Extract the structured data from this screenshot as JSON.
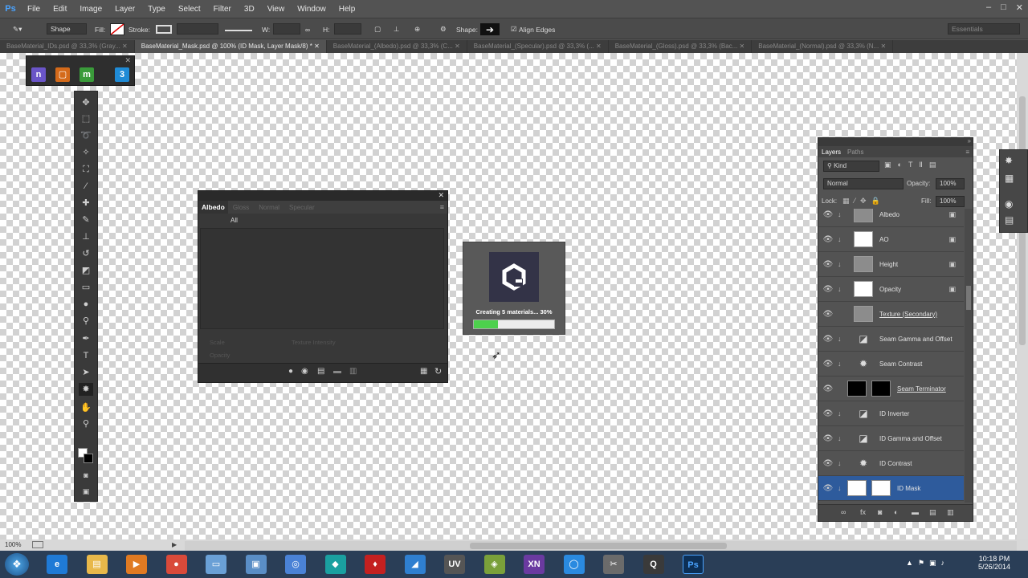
{
  "app": {
    "logo": "Ps"
  },
  "menu": [
    "File",
    "Edit",
    "Image",
    "Layer",
    "Type",
    "Select",
    "Filter",
    "3D",
    "View",
    "Window",
    "Help"
  ],
  "window_controls": [
    "–",
    "□",
    "✕"
  ],
  "options": {
    "tool_preset": "Shape",
    "fill_label": "Fill:",
    "stroke_label": "Stroke:",
    "w_label": "W:",
    "h_label": "H:",
    "shape_label": "Shape:",
    "align_edges": "Align Edges",
    "workspace": "Essentials"
  },
  "doc_tabs": [
    {
      "label": "BaseMaterial_IDs.psd @ 33,3% (Gray...",
      "active": false
    },
    {
      "label": "BaseMaterial_Mask.psd @ 100% (ID Mask, Layer Mask/8) *",
      "active": true
    },
    {
      "label": "BaseMaterial_(Albedo).psd @ 33,3% (C...",
      "active": false
    },
    {
      "label": "BaseMaterial_(Specular).psd @ 33,3% (...",
      "active": false
    },
    {
      "label": "BaseMaterial_(Gloss).psd @ 33,3% (Bac...",
      "active": false
    },
    {
      "label": "BaseMaterial_(Normal).psd @ 33,3% (N...",
      "active": false
    }
  ],
  "plugins": [
    {
      "glyph": "n",
      "color": "#6a55c8"
    },
    {
      "glyph": "▢",
      "color": "#d46a1a"
    },
    {
      "glyph": "m",
      "color": "#3a9b3a"
    },
    {
      "glyph": "3",
      "color": "#1f8bd6"
    }
  ],
  "material_panel": {
    "tabs": [
      "Albedo",
      "Gloss",
      "Normal",
      "Specular"
    ],
    "filter": "All",
    "sliders": [
      "Scale",
      "Texture Intensity",
      "Opacity"
    ]
  },
  "quixel_popup": {
    "status": "Creating 5 materials... 30%",
    "progress": 0.3
  },
  "layers_panel": {
    "tabs": [
      "Layers",
      "Paths"
    ],
    "kind": "Kind",
    "blend": "Normal",
    "opacity_label": "Opacity:",
    "opacity": "100%",
    "lock_label": "Lock:",
    "fill_label": "Fill:",
    "fill": "100%",
    "rows": [
      {
        "name": "Albedo",
        "thumb": "gray",
        "clip": true,
        "smart": true
      },
      {
        "name": "AO",
        "thumb": "white",
        "clip": true,
        "smart": true
      },
      {
        "name": "Height",
        "thumb": "gray",
        "clip": true,
        "smart": true
      },
      {
        "name": "Opacity",
        "thumb": "white",
        "clip": true,
        "smart": true
      },
      {
        "name": "Texture (Secondary)",
        "thumb": "gray",
        "clip": false,
        "smart": false
      },
      {
        "name": "Seam Gamma and Offset",
        "thumb": "curves",
        "clip": true,
        "smart": false
      },
      {
        "name": "Seam Contrast",
        "thumb": "sun",
        "clip": true,
        "smart": false
      },
      {
        "name": "Seam Terminator",
        "thumb": "blackmask",
        "clip": false,
        "smart": false
      },
      {
        "name": "ID Inverter",
        "thumb": "curves",
        "clip": true,
        "smart": false
      },
      {
        "name": "ID Gamma and Offset",
        "thumb": "curves",
        "clip": true,
        "smart": false
      },
      {
        "name": "ID Contrast",
        "thumb": "sun",
        "clip": true,
        "smart": false
      },
      {
        "name": "ID Mask",
        "thumb": "whitemask",
        "clip": true,
        "smart": false
      }
    ]
  },
  "status": {
    "zoom": "100%"
  },
  "clock": {
    "time": "10:18 PM",
    "date": "5/26/2014"
  },
  "taskbar_apps": [
    {
      "name": "ie",
      "glyph": "e",
      "color": "#1f7ad6"
    },
    {
      "name": "explorer",
      "glyph": "▤",
      "color": "#e8b84a"
    },
    {
      "name": "media",
      "glyph": "▶",
      "color": "#e07a22"
    },
    {
      "name": "chrome",
      "glyph": "●",
      "color": "#d94a3a"
    },
    {
      "name": "notepad",
      "glyph": "▭",
      "color": "#6aa0d6"
    },
    {
      "name": "window",
      "glyph": "▣",
      "color": "#5a8ec6"
    },
    {
      "name": "globe",
      "glyph": "◎",
      "color": "#4a82d6"
    },
    {
      "name": "app-teal",
      "glyph": "◆",
      "color": "#1aa0a0"
    },
    {
      "name": "fire",
      "glyph": "♦",
      "color": "#c42020"
    },
    {
      "name": "blue",
      "glyph": "◢",
      "color": "#2f7fd0"
    },
    {
      "name": "uv",
      "glyph": "UV",
      "color": "#555555"
    },
    {
      "name": "green",
      "glyph": "◈",
      "color": "#7aa03a"
    },
    {
      "name": "xn",
      "glyph": "XN",
      "color": "#6a3aa0"
    },
    {
      "name": "circle",
      "glyph": "◯",
      "color": "#2a8ae0"
    },
    {
      "name": "tool",
      "glyph": "✂",
      "color": "#6b6b6b"
    },
    {
      "name": "quixel",
      "glyph": "Q",
      "color": "#3a3a3a"
    },
    {
      "name": "photoshop",
      "glyph": "Ps",
      "color": "#0d2f55"
    }
  ]
}
